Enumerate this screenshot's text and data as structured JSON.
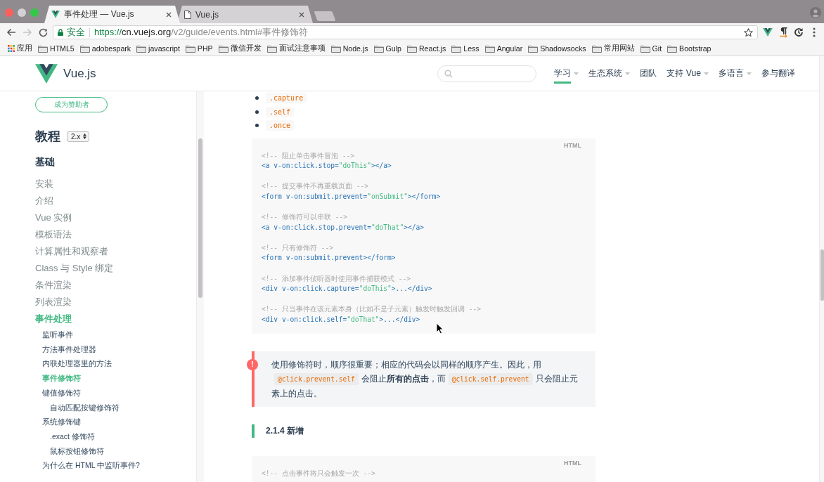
{
  "browser": {
    "tabs": [
      {
        "kind": "vue",
        "title": "事件处理 — Vue.js",
        "selected": true
      },
      {
        "kind": "page",
        "title": "Vue.js",
        "selected": false
      }
    ],
    "nav_buttons": [
      {
        "kind": "back",
        "disabled": false
      },
      {
        "kind": "forward",
        "disabled": true
      },
      {
        "kind": "reload",
        "disabled": false
      }
    ],
    "address_bar": {
      "security": "安全",
      "scheme": "https://",
      "host": "cn.vuejs.org",
      "path": "/v2/guide/events.html#事件修饰符",
      "bookmarked": false
    },
    "bookmarks": [
      {
        "kind": "apps",
        "label": "应用"
      },
      {
        "kind": "folder",
        "label": "HTML5"
      },
      {
        "kind": "folder",
        "label": "adobespark"
      },
      {
        "kind": "folder",
        "label": "javascript"
      },
      {
        "kind": "folder",
        "label": "PHP"
      },
      {
        "kind": "folder",
        "label": "微信开发"
      },
      {
        "kind": "folder",
        "label": "面试注意事项"
      },
      {
        "kind": "folder",
        "label": "Node.js"
      },
      {
        "kind": "folder",
        "label": "Gulp"
      },
      {
        "kind": "folder",
        "label": "React.js"
      },
      {
        "kind": "folder",
        "label": "Less"
      },
      {
        "kind": "folder",
        "label": "Angular"
      },
      {
        "kind": "folder",
        "label": "Shadowsocks"
      },
      {
        "kind": "folder",
        "label": "常用网站"
      },
      {
        "kind": "folder",
        "label": "Git"
      },
      {
        "kind": "folder",
        "label": "Bootstrap"
      }
    ]
  },
  "site_header": {
    "logo_text": "Vue.js",
    "nav": [
      {
        "label": "学习",
        "selected": true,
        "dropdown": true
      },
      {
        "label": "生态系统",
        "selected": false,
        "dropdown": true
      },
      {
        "label": "团队",
        "selected": false,
        "dropdown": false
      },
      {
        "label": "支持 Vue",
        "selected": false,
        "dropdown": true
      },
      {
        "label": "多语言",
        "selected": false,
        "dropdown": true
      },
      {
        "label": "参与翻译",
        "selected": false,
        "dropdown": false
      }
    ]
  },
  "sidebar": {
    "sponsor_button": "成为赞助者",
    "title": "教程",
    "version": "2.x",
    "section": "基础",
    "items": [
      {
        "label": "安装",
        "selected": false
      },
      {
        "label": "介绍",
        "selected": false
      },
      {
        "label": "Vue 实例",
        "selected": false
      },
      {
        "label": "模板语法",
        "selected": false
      },
      {
        "label": "计算属性和观察者",
        "selected": false
      },
      {
        "label": "Class 与 Style 绑定",
        "selected": false
      },
      {
        "label": "条件渲染",
        "selected": false
      },
      {
        "label": "列表渲染",
        "selected": false
      },
      {
        "label": "事件处理",
        "selected": true,
        "children": [
          {
            "label": "监听事件",
            "selected": false
          },
          {
            "label": "方法事件处理器",
            "selected": false
          },
          {
            "label": "内联处理器里的方法",
            "selected": false
          },
          {
            "label": "事件修饰符",
            "selected": true
          },
          {
            "label": "键值修饰符",
            "selected": false,
            "children": [
              {
                "label": "自动匹配按键修饰符",
                "selected": false
              }
            ]
          },
          {
            "label": "系统修饰键",
            "selected": false,
            "children": [
              {
                "label": ".exact 修饰符",
                "selected": false
              },
              {
                "label": "鼠标按钮修饰符",
                "selected": false
              }
            ]
          },
          {
            "label": "为什么在 HTML 中监听事件?",
            "selected": false
          }
        ]
      }
    ]
  },
  "content": {
    "blocks": [
      {
        "kind": "list",
        "items": [
          ".capture",
          ".self",
          ".once"
        ]
      },
      {
        "kind": "code",
        "language": "HTML",
        "snippets": [
          {
            "comment": "<!-- 阻止单击事件冒泡 -->",
            "code": [
              {
                "kind": "tag",
                "text": "<a v-on:click.stop="
              },
              {
                "kind": "string",
                "text": "\"doThis\""
              },
              {
                "kind": "tag",
                "text": "></a>"
              }
            ]
          },
          {
            "comment": "<!-- 提交事件不再重载页面 -->",
            "code": [
              {
                "kind": "tag",
                "text": "<form v-on:submit.prevent="
              },
              {
                "kind": "string",
                "text": "\"onSubmit\""
              },
              {
                "kind": "tag",
                "text": "></form>"
              }
            ]
          },
          {
            "comment": "<!-- 修饰符可以串联 -->",
            "code": [
              {
                "kind": "tag",
                "text": "<a v-on:click.stop.prevent="
              },
              {
                "kind": "string",
                "text": "\"doThat\""
              },
              {
                "kind": "tag",
                "text": "></a>"
              }
            ]
          },
          {
            "comment": "<!-- 只有修饰符 -->",
            "code": [
              {
                "kind": "tag",
                "text": "<form v-on:submit.prevent></form>"
              }
            ]
          },
          {
            "comment": "<!-- 添加事件侦听器时使用事件捕获模式 -->",
            "code": [
              {
                "kind": "tag",
                "text": "<div v-on:click.capture="
              },
              {
                "kind": "string",
                "text": "\"doThis\""
              },
              {
                "kind": "tag",
                "text": ">...</div>"
              }
            ]
          },
          {
            "comment": "<!-- 只当事件在该元素本身（比如不是子元素）触发时触发回调 -->",
            "code": [
              {
                "kind": "tag",
                "text": "<div v-on:click.self="
              },
              {
                "kind": "string",
                "text": "\"doThat\""
              },
              {
                "kind": "tag",
                "text": ">...</div>"
              }
            ]
          }
        ]
      },
      {
        "kind": "tip",
        "icon": "!",
        "segments": [
          {
            "kind": "text",
            "text": "使用修饰符时，顺序很重要；相应的代码会以同样的顺序产生。因此，用"
          },
          {
            "kind": "code",
            "text": "@click.prevent.self"
          },
          {
            "kind": "text",
            "text": "会阻止**所有的点击**，而"
          },
          {
            "kind": "code",
            "text": "@click.self.prevent"
          },
          {
            "kind": "text",
            "text": "只会阻止元素上的点击。"
          }
        ]
      },
      {
        "kind": "heading",
        "text": "2.1.4 新增"
      },
      {
        "kind": "code",
        "language": "HTML",
        "snippets": [
          {
            "comment": "<!-- 点击事件将只会触发一次 -->"
          }
        ]
      }
    ]
  }
}
